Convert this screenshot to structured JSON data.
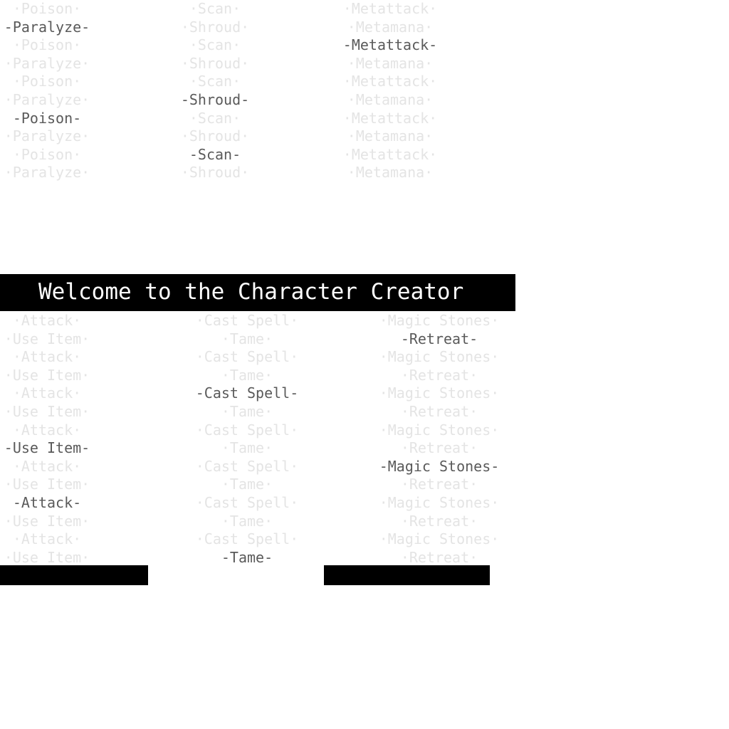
{
  "title": "Welcome to the Character Creator",
  "colors": {
    "active_text": "#5a5a5a",
    "ghost_text": "#e4e4e4",
    "banner_bg": "#000000",
    "banner_text": "#ffffff",
    "page_bg": "#ffffff"
  },
  "upper_columns": [
    {
      "name": "status-effects",
      "rows": [
        {
          "label": "·Poison·",
          "active": false
        },
        {
          "label": "-Paralyze-",
          "active": true
        },
        {
          "label": "·Poison·",
          "active": false
        },
        {
          "label": "·Paralyze·",
          "active": false
        },
        {
          "label": "·Poison·",
          "active": false
        },
        {
          "label": "·Paralyze·",
          "active": false
        },
        {
          "label": "-Poison-",
          "active": true
        },
        {
          "label": "·Paralyze·",
          "active": false
        },
        {
          "label": "·Poison·",
          "active": false
        },
        {
          "label": "·Paralyze·",
          "active": false
        }
      ]
    },
    {
      "name": "utility-spells",
      "rows": [
        {
          "label": "·Scan·",
          "active": false
        },
        {
          "label": "·Shroud·",
          "active": false
        },
        {
          "label": "·Scan·",
          "active": false
        },
        {
          "label": "·Shroud·",
          "active": false
        },
        {
          "label": "·Scan·",
          "active": false
        },
        {
          "label": "-Shroud-",
          "active": true
        },
        {
          "label": "·Scan·",
          "active": false
        },
        {
          "label": "·Shroud·",
          "active": false
        },
        {
          "label": "-Scan-",
          "active": true
        },
        {
          "label": "·Shroud·",
          "active": false
        }
      ]
    },
    {
      "name": "meta-skills",
      "rows": [
        {
          "label": "·Metattack·",
          "active": false
        },
        {
          "label": "·Metamana·",
          "active": false
        },
        {
          "label": "-Metattack-",
          "active": true
        },
        {
          "label": "·Metamana·",
          "active": false
        },
        {
          "label": "·Metattack·",
          "active": false
        },
        {
          "label": "·Metamana·",
          "active": false
        },
        {
          "label": "·Metattack·",
          "active": false
        },
        {
          "label": "·Metamana·",
          "active": false
        },
        {
          "label": "·Metattack·",
          "active": false
        },
        {
          "label": "·Metamana·",
          "active": false
        }
      ]
    }
  ],
  "lower_columns": [
    {
      "name": "basic-actions",
      "rows": [
        {
          "label": "·Attack·",
          "active": false
        },
        {
          "label": "·Use Item·",
          "active": false
        },
        {
          "label": "·Attack·",
          "active": false
        },
        {
          "label": "·Use Item·",
          "active": false
        },
        {
          "label": "·Attack·",
          "active": false
        },
        {
          "label": "·Use Item·",
          "active": false
        },
        {
          "label": "·Attack·",
          "active": false
        },
        {
          "label": "-Use Item-",
          "active": true
        },
        {
          "label": "·Attack·",
          "active": false
        },
        {
          "label": "·Use Item·",
          "active": false
        },
        {
          "label": "-Attack-",
          "active": true
        },
        {
          "label": "·Use Item·",
          "active": false
        },
        {
          "label": "·Attack·",
          "active": false
        },
        {
          "label": "·Use Item·",
          "active": false
        }
      ]
    },
    {
      "name": "magic-actions",
      "rows": [
        {
          "label": "·Cast Spell·",
          "active": false
        },
        {
          "label": "·Tame·",
          "active": false
        },
        {
          "label": "·Cast Spell·",
          "active": false
        },
        {
          "label": "·Tame·",
          "active": false
        },
        {
          "label": "-Cast Spell-",
          "active": true
        },
        {
          "label": "·Tame·",
          "active": false
        },
        {
          "label": "·Cast Spell·",
          "active": false
        },
        {
          "label": "·Tame·",
          "active": false
        },
        {
          "label": "·Cast Spell·",
          "active": false
        },
        {
          "label": "·Tame·",
          "active": false
        },
        {
          "label": "·Cast Spell·",
          "active": false
        },
        {
          "label": "·Tame·",
          "active": false
        },
        {
          "label": "·Cast Spell·",
          "active": false
        },
        {
          "label": "-Tame-",
          "active": true
        }
      ]
    },
    {
      "name": "special-actions",
      "rows": [
        {
          "label": "·Magic Stones·",
          "active": false
        },
        {
          "label": "-Retreat-",
          "active": true
        },
        {
          "label": "·Magic Stones·",
          "active": false
        },
        {
          "label": "·Retreat·",
          "active": false
        },
        {
          "label": "·Magic Stones·",
          "active": false
        },
        {
          "label": "·Retreat·",
          "active": false
        },
        {
          "label": "·Magic Stones·",
          "active": false
        },
        {
          "label": "·Retreat·",
          "active": false
        },
        {
          "label": "-Magic Stones-",
          "active": true
        },
        {
          "label": "·Retreat·",
          "active": false
        },
        {
          "label": "·Magic Stones·",
          "active": false
        },
        {
          "label": "·Retreat·",
          "active": false
        },
        {
          "label": "·Magic Stones·",
          "active": false
        },
        {
          "label": "·Retreat·",
          "active": false
        }
      ]
    }
  ]
}
